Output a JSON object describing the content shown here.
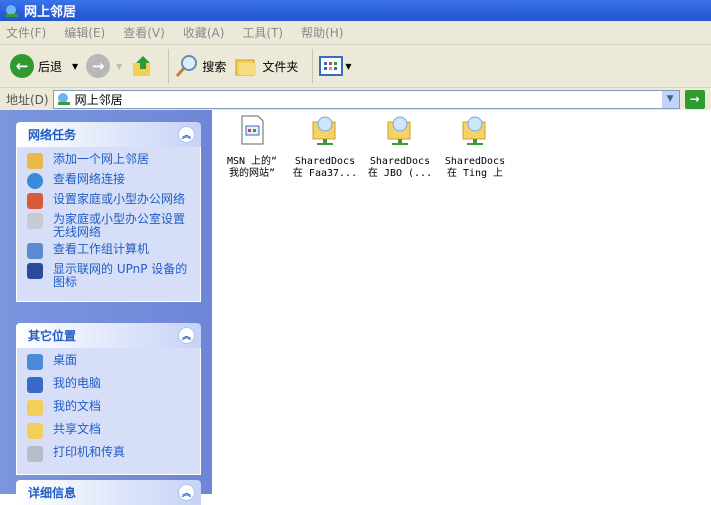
{
  "window": {
    "title": "网上邻居"
  },
  "menu": [
    "文件(F)",
    "编辑(E)",
    "查看(V)",
    "收藏(A)",
    "工具(T)",
    "帮助(H)"
  ],
  "toolbar": {
    "back": "后退",
    "search": "搜索",
    "folders": "文件夹"
  },
  "address": {
    "label": "地址(D)",
    "value": "网上邻居"
  },
  "panels": [
    {
      "title": "网络任务",
      "items": [
        "添加一个网上邻居",
        "查看网络连接",
        "设置家庭或小型办公网络",
        "为家庭或小型办公室设置无线网络",
        "查看工作组计算机",
        "显示联网的 UPnP 设备的图标"
      ]
    },
    {
      "title": "其它位置",
      "items": [
        "桌面",
        "我的电脑",
        "我的文档",
        "共享文档",
        "打印机和传真"
      ]
    },
    {
      "title": "详细信息"
    }
  ],
  "files": [
    {
      "line1": "MSN 上的“",
      "line2": "我的网站”"
    },
    {
      "line1": "SharedDocs",
      "line2": "在 Faa37..."
    },
    {
      "line1": "SharedDocs",
      "line2": "在 JBO (..."
    },
    {
      "line1": "SharedDocs",
      "line2": "在 Ting 上"
    }
  ]
}
